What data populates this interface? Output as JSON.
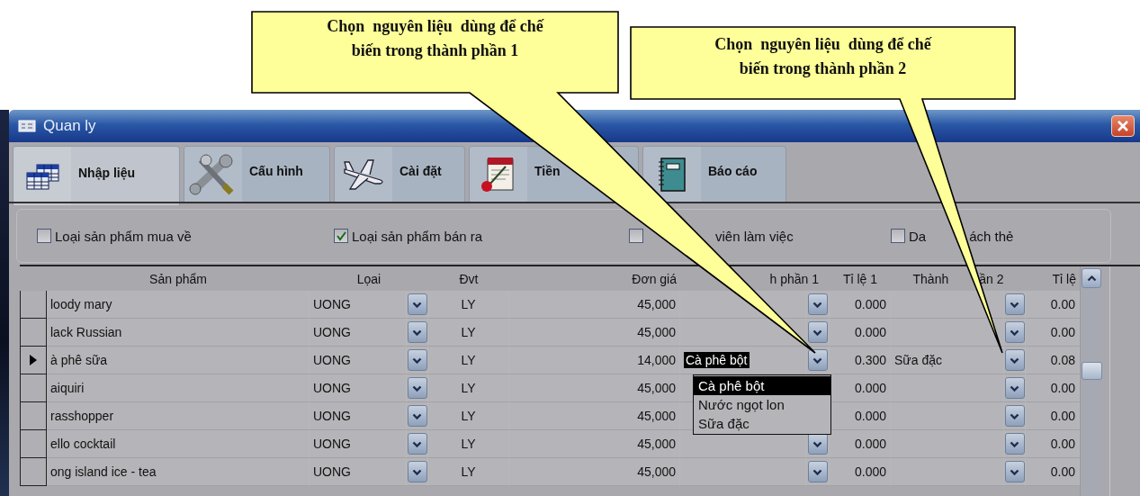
{
  "window": {
    "title": "Quan ly"
  },
  "tabs": [
    {
      "label": "Nhập liệu",
      "selected": true
    },
    {
      "label": "Cấu hình",
      "selected": false
    },
    {
      "label": "Cài đặt",
      "selected": false
    },
    {
      "label": "Tiền",
      "selected": false
    },
    {
      "label": "Báo cáo",
      "selected": false
    }
  ],
  "filters": [
    {
      "label_parts": [
        "Loại sản phẩm mua về"
      ],
      "checked": false
    },
    {
      "label_parts": [
        "Loại sản phẩm bán ra"
      ],
      "checked": true
    },
    {
      "label_parts": [
        "viên làm việc"
      ],
      "checked": false
    },
    {
      "label_parts": [
        "Da",
        "ách thẻ"
      ],
      "checked": false
    }
  ],
  "table": {
    "columns": [
      {
        "label_parts": [
          "Sản phẩm"
        ]
      },
      {
        "label_parts": [
          "Lọai"
        ]
      },
      {
        "label_parts": [
          "Đvt"
        ]
      },
      {
        "label_parts": [
          "Đơn giá"
        ]
      },
      {
        "label_parts": [
          "h phần 1"
        ]
      },
      {
        "label_parts": [
          "Tỉ lệ 1"
        ]
      },
      {
        "label_parts": [
          "Thành",
          "ần 2"
        ]
      },
      {
        "label_parts": [
          "Tỉ lệ"
        ]
      }
    ],
    "rows": [
      {
        "selected": false,
        "product": "loody mary",
        "type": "UONG",
        "unit": "LY",
        "price": "45,000",
        "component_1": "",
        "ratio_1": "0.000",
        "component_2": "",
        "ratio_2": "0.00"
      },
      {
        "selected": false,
        "product": "lack Russian",
        "type": "UONG",
        "unit": "LY",
        "price": "45,000",
        "component_1": "",
        "ratio_1": "0.000",
        "component_2": "",
        "ratio_2": "0.00"
      },
      {
        "selected": true,
        "product": "à phê sữa",
        "type": "UONG",
        "unit": "LY",
        "price": "14,000",
        "component_1": "Cà phê bột",
        "ratio_1": "0.300",
        "component_2": "Sữa đặc",
        "ratio_2": "0.08",
        "component_1_options": [
          {
            "label": "Cà phê bột",
            "selected": true
          },
          {
            "label": "Nước ngọt lon",
            "selected": false
          },
          {
            "label": "Sữa đặc",
            "selected": false
          }
        ]
      },
      {
        "selected": false,
        "product": "aiquiri",
        "type": "UONG",
        "unit": "LY",
        "price": "45,000",
        "component_1": "",
        "ratio_1": "0.000",
        "component_2": "",
        "ratio_2": "0.00"
      },
      {
        "selected": false,
        "product": "rasshopper",
        "type": "UONG",
        "unit": "LY",
        "price": "45,000",
        "component_1": "",
        "ratio_1": "0.000",
        "component_2": "",
        "ratio_2": "0.00"
      },
      {
        "selected": false,
        "product": "ello cocktail",
        "type": "UONG",
        "unit": "LY",
        "price": "45,000",
        "component_1": "",
        "ratio_1": "0.000",
        "component_2": "",
        "ratio_2": "0.00"
      },
      {
        "selected": false,
        "product": "ong island ice - tea",
        "type": "UONG",
        "unit": "LY",
        "price": "45,000",
        "component_1": "",
        "ratio_1": "0.000",
        "component_2": "",
        "ratio_2": "0.00"
      }
    ]
  },
  "callouts": [
    {
      "text_lines": [
        "Chọn  nguyên liệu  dùng để chế",
        "biến trong thành phần 1"
      ]
    },
    {
      "text_lines": [
        "Chọn  nguyên liệu  dùng để chế",
        "biến trong thành phần 2"
      ]
    }
  ]
}
